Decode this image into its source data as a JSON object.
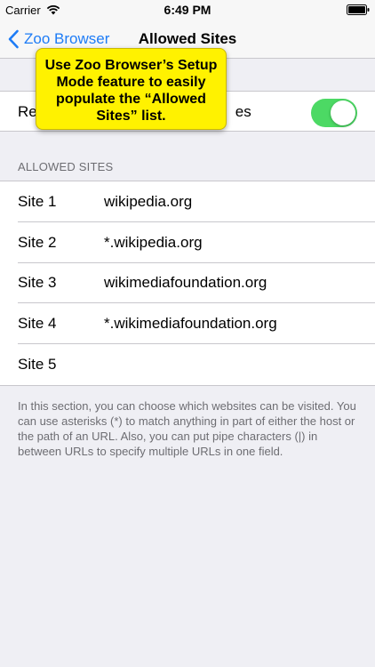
{
  "status_bar": {
    "carrier": "Carrier",
    "time": "6:49 PM",
    "icons": [
      "wifi-icon",
      "battery-icon"
    ]
  },
  "nav": {
    "back_label": "Zoo Browser",
    "title": "Allowed Sites",
    "accent_color": "#1e7cf6"
  },
  "toggle": {
    "label_left": "Re",
    "label_right": "es",
    "on": true,
    "on_color": "#4cd964"
  },
  "callout": {
    "text": "Use Zoo Browser’s Setup Mode feature to easily populate the “Allowed Sites” list.",
    "color": "#fff200"
  },
  "sites": {
    "header": "ALLOWED SITES",
    "rows": [
      {
        "label": "Site 1",
        "value": "wikipedia.org"
      },
      {
        "label": "Site 2",
        "value": "*.wikipedia.org"
      },
      {
        "label": "Site 3",
        "value": "wikimediafoundation.org"
      },
      {
        "label": "Site 4",
        "value": "*.wikimediafoundation.org"
      },
      {
        "label": "Site 5",
        "value": ""
      }
    ],
    "footer": "In this section, you can choose which websites can be visited. You can use asterisks (*) to match anything in part of either the host or the path of an URL. Also, you can put pipe characters (|) in between URLs to specify multiple URLs in one field."
  }
}
